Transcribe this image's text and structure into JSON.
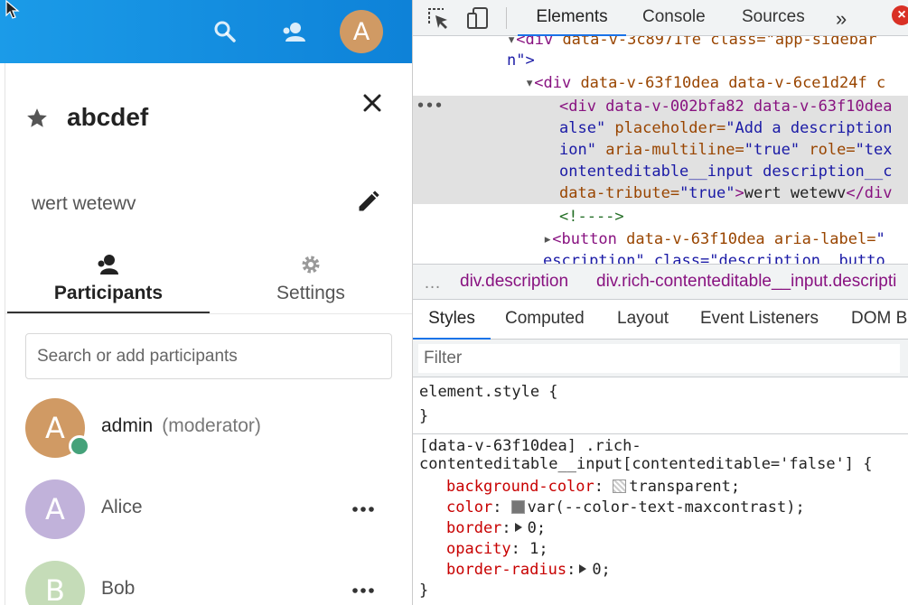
{
  "app": {
    "header": {
      "avatar_letter": "A"
    },
    "room": {
      "name": "abcdef",
      "description": "wert wetewv"
    },
    "tabs": [
      {
        "label": "Participants"
      },
      {
        "label": "Settings"
      }
    ],
    "search": {
      "placeholder": "Search or add participants"
    },
    "participants": [
      {
        "letter": "A",
        "name": "admin",
        "role": "(moderator)",
        "color": "#d09a64",
        "online": true
      },
      {
        "letter": "A",
        "name": "Alice",
        "role": "",
        "color": "#c1b2da",
        "online": false
      },
      {
        "letter": "B",
        "name": "Bob",
        "role": "",
        "color": "#c5dcb8",
        "online": false
      }
    ]
  },
  "devtools": {
    "tabs": {
      "elements": "Elements",
      "console": "Console",
      "sources": "Sources",
      "more": "»"
    },
    "dom": {
      "line1_tag": "<div",
      "line1_rest": " data-v-3c8971fe class=\"app-sidebar",
      "line2": "n\">",
      "line3_tag": "<div",
      "line3_attrs": " data-v-63f10dea data-v-6ce1d24f c",
      "sel_line1": "<div data-v-002bfa82 data-v-63f10dea",
      "sel_line2_a": "alse\"",
      "sel_line2_b": " placeholder=",
      "sel_line2_c": "\"Add a description",
      "sel_line3_a": "ion\"",
      "sel_line3_b": " aria-multiline=",
      "sel_line3_c": "\"true\"",
      "sel_line3_d": " role=",
      "sel_line3_e": "\"tex",
      "sel_line4": "ontenteditable__input description__c",
      "sel_line5_attr": "data-tribute=",
      "sel_line5_val": "\"true\"",
      "sel_line5_close": ">",
      "sel_line5_text": "wert wetewv",
      "sel_line5_end": "</div",
      "comment": "<!---->",
      "button_tag": "<button",
      "button_attr": " data-v-63f10dea aria-label=",
      "button_val": "\"",
      "last_line": "escription\" class=\"description__butto"
    },
    "breadcrumb": {
      "dots": "…",
      "item1": "div.description",
      "item2": "div.rich-contenteditable__input.descripti"
    },
    "panel_tabs": {
      "styles": "Styles",
      "computed": "Computed",
      "layout": "Layout",
      "listeners": "Event Listeners",
      "dom": "DOM Br"
    },
    "filter": {
      "placeholder": "Filter"
    },
    "styles": {
      "element_open": "element.style {",
      "element_close": "}",
      "rule_selector1": "[data-v-63f10dea] .rich-",
      "rule_selector2": "contenteditable__input[contenteditable='false'] {",
      "props": [
        {
          "name": "background-color",
          "value": "transparent;",
          "swatch": "transparent"
        },
        {
          "name": "color",
          "value": "var(--color-text-maxcontrast);",
          "swatch": "#767676"
        },
        {
          "name": "border",
          "value": "0;",
          "expand": true
        },
        {
          "name": "opacity",
          "value": "1;"
        },
        {
          "name": "border-radius",
          "value": "0;",
          "expand": true
        }
      ],
      "rule_close": "}"
    }
  }
}
